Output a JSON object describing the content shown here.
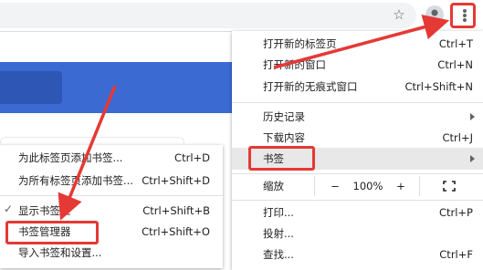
{
  "toolbar": {
    "bookmark_icon": "star-outline-icon",
    "profile_icon": "person-icon",
    "menu_icon": "three-dot-vertical-icon"
  },
  "main_menu": {
    "items": [
      {
        "label": "打开新的标签页",
        "shortcut": "Ctrl+T"
      },
      {
        "label": "打开新的窗口",
        "shortcut": "Ctrl+N"
      },
      {
        "label": "打开新的无痕式窗口",
        "shortcut": "Ctrl+Shift+N"
      },
      {
        "label": "历史记录",
        "shortcut": ""
      },
      {
        "label": "下载内容",
        "shortcut": "Ctrl+J"
      },
      {
        "label": "书签",
        "shortcut": ""
      }
    ],
    "zoom": {
      "label": "缩放",
      "minus": "−",
      "value": "100%",
      "plus": "+"
    },
    "items2": [
      {
        "label": "打印...",
        "shortcut": "Ctrl+P"
      },
      {
        "label": "投射...",
        "shortcut": ""
      },
      {
        "label": "查找...",
        "shortcut": "Ctrl+F"
      }
    ]
  },
  "bookmarks_menu": {
    "items": [
      {
        "label": "为此标签页添加书签...",
        "shortcut": "Ctrl+D"
      },
      {
        "label": "为所有标签页添加书签...",
        "shortcut": "Ctrl+Shift+D"
      },
      {
        "label": "显示书签栏",
        "shortcut": "Ctrl+Shift+B",
        "checked": true
      },
      {
        "label": "书签管理器",
        "shortcut": "Ctrl+Shift+O"
      },
      {
        "label": "导入书签和设置...",
        "shortcut": ""
      }
    ]
  },
  "colors": {
    "accent_red": "#e53935",
    "page_blue": "#3b6ad3"
  }
}
